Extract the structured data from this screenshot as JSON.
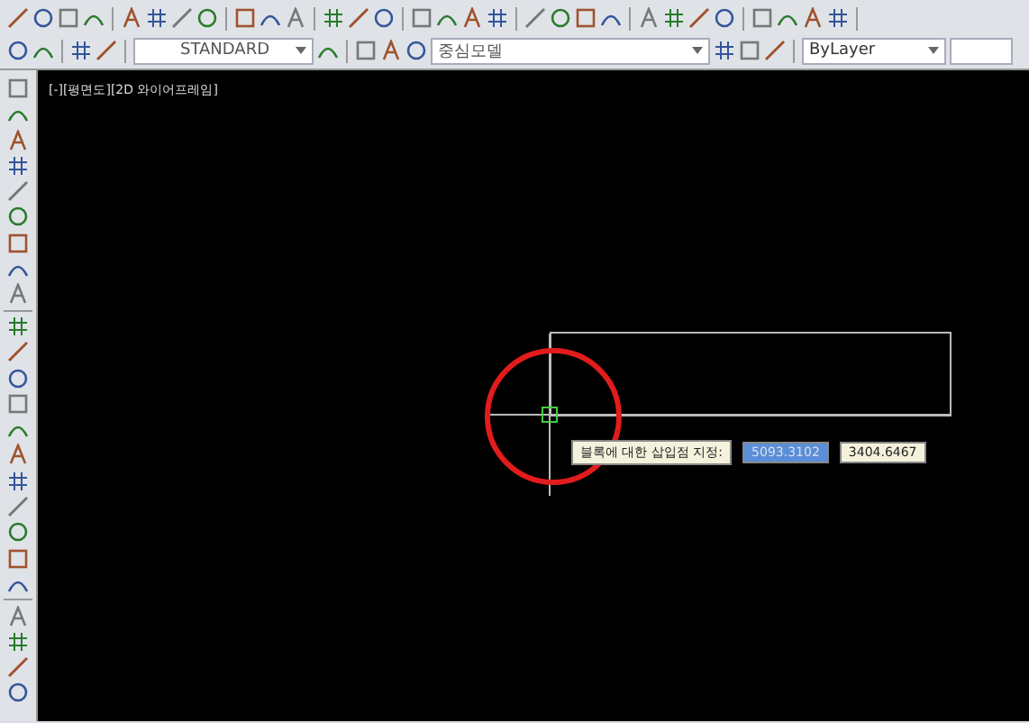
{
  "toolbar_row_2": {
    "text_style": "STANDARD",
    "layer": "중심모델",
    "property_setting": "ByLayer"
  },
  "viewport": {
    "label": "[-][평면도][2D 와이어프레임]"
  },
  "command_tooltip": {
    "prompt": "블록에 대한 삽입점 지정:",
    "fields": [
      {
        "value": "5093.3102",
        "selected": true
      },
      {
        "value": "3404.6467",
        "selected": false
      }
    ]
  }
}
